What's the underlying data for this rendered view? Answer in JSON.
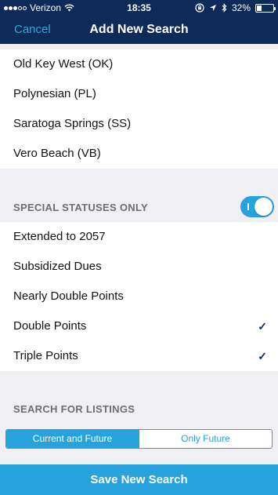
{
  "status_bar": {
    "carrier": "Verizon",
    "time": "18:35",
    "battery": "32%",
    "battery_level": 0.32,
    "icons": [
      "signal-dots",
      "wifi-icon",
      "lock-rotation-icon",
      "location-arrow-icon",
      "bluetooth-icon",
      "battery-icon"
    ]
  },
  "nav": {
    "cancel_label": "Cancel",
    "title": "Add New Search"
  },
  "resorts": [
    "Old Key West (OK)",
    "Polynesian (PL)",
    "Saratoga Springs (SS)",
    "Vero Beach (VB)"
  ],
  "special_statuses": {
    "label": "SPECIAL STATUSES ONLY",
    "toggle_on": true,
    "items": [
      {
        "label": "Extended to 2057",
        "checked": false
      },
      {
        "label": "Subsidized Dues",
        "checked": false
      },
      {
        "label": "Nearly Double Points",
        "checked": false
      },
      {
        "label": "Double Points",
        "checked": true
      },
      {
        "label": "Triple Points",
        "checked": true
      }
    ]
  },
  "listings": {
    "label": "SEARCH FOR LISTINGS",
    "options": [
      "Current and Future",
      "Only Future"
    ],
    "selected": "Current and Future"
  },
  "save_label": "Save New Search",
  "colors": {
    "header": "#0e2a58",
    "accent": "#27a2dd",
    "background": "#efeff4",
    "checkmark": "#0e2a58"
  }
}
